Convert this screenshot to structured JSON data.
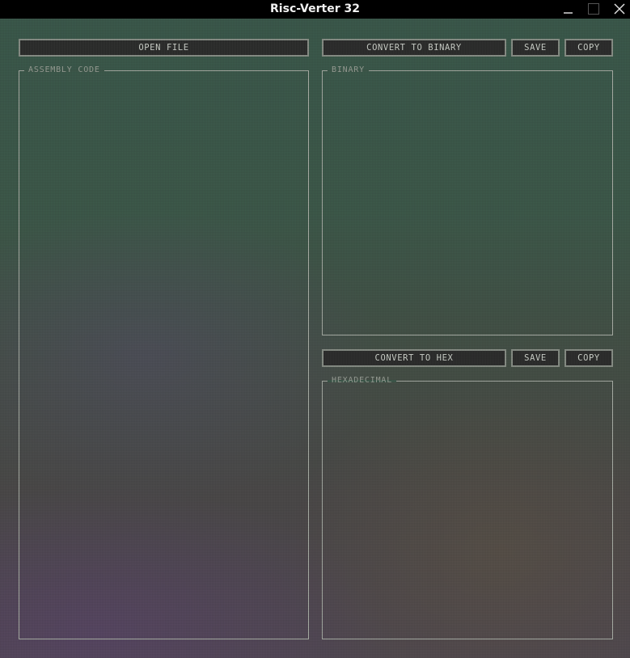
{
  "window": {
    "title": "Risc-Verter 32"
  },
  "left": {
    "open_file_label": "OPEN FILE",
    "assembly_label": "ASSEMBLY CODE",
    "assembly_text": ""
  },
  "binary": {
    "convert_label": "CONVERT TO BINARY",
    "save_label": "SAVE",
    "copy_label": "COPY",
    "panel_label": "BINARY",
    "text": ""
  },
  "hex": {
    "convert_label": "CONVERT TO HEX",
    "save_label": "SAVE",
    "copy_label": "COPY",
    "panel_label": "HEXADECIMAL",
    "text": ""
  },
  "icons": {
    "minimize": "minimize-icon",
    "maximize": "maximize-icon",
    "close": "close-icon"
  },
  "colors": {
    "button_bg": "#2a2b2a",
    "button_border": "#8a9088",
    "frame_border": "#a9aea6",
    "label_text": "#9aa097"
  }
}
